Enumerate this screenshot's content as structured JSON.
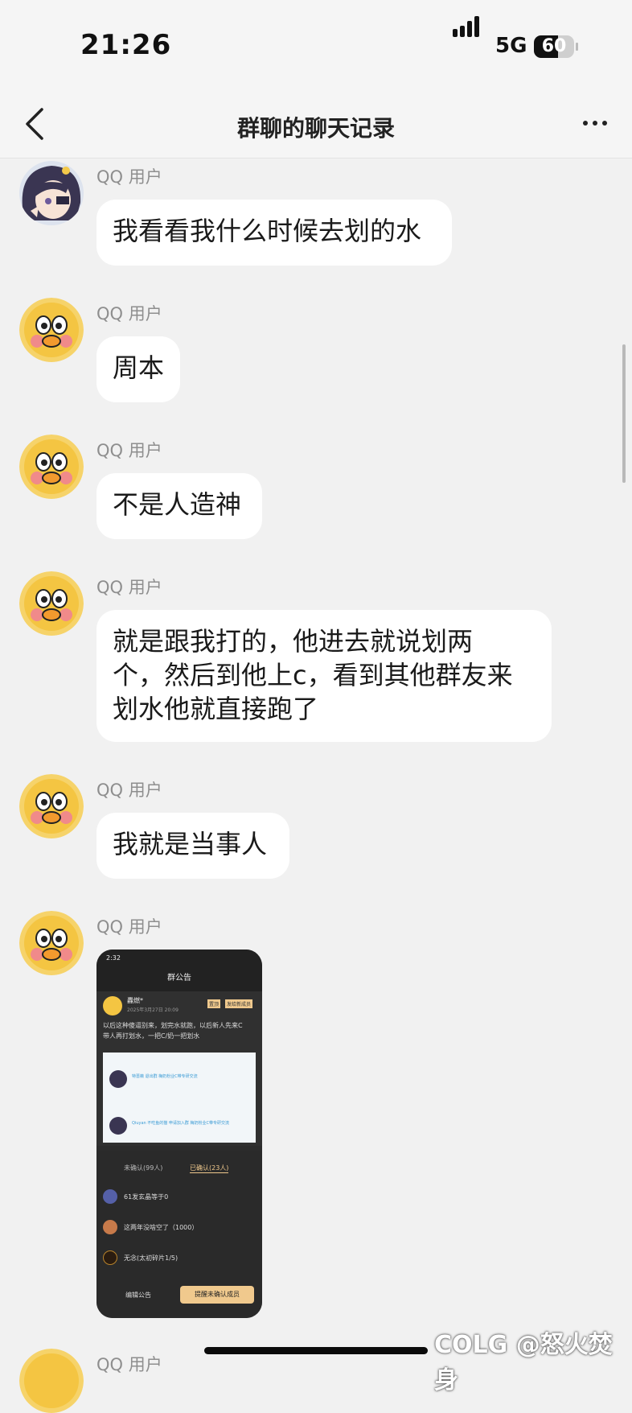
{
  "status_bar": {
    "time": "21:26",
    "network": "5G",
    "battery": "60",
    "battery_level": 0.6
  },
  "nav": {
    "title": "群聊的聊天记录"
  },
  "messages": [
    {
      "sender": "QQ 用户",
      "text": "我看看我什么时候去划的水"
    },
    {
      "sender": "QQ 用户",
      "text": "周本"
    },
    {
      "sender": "QQ 用户",
      "text": "不是人造神"
    },
    {
      "sender": "QQ 用户",
      "lines": [
        "就是跟我打的，他进去就说划两",
        "个，然后到他上c，看到其他群友来",
        "划水他就直接跑了"
      ]
    },
    {
      "sender": "QQ 用户",
      "text": "我就是当事人"
    },
    {
      "sender": "QQ 用户"
    },
    {
      "sender": "QQ 用户"
    }
  ],
  "embedded_screenshot": {
    "time": "2:32",
    "title": "群公告",
    "author": "轟燃*",
    "date": "2025年3月27日 20:09",
    "tag_pinned": "置顶",
    "tag_new": "发给新成员",
    "text_lines": [
      "以后这种傻逼别来，划完水就跑，以后新人先来C",
      "带人再打划水，一把C/奶一把划水"
    ],
    "img_row1": "特蔷薇 退出群 梅奶粉业C带专研交流",
    "img_row2": "Qiuyan 不吃鱼的猫 申请加入群 梅奶粉业C带专研交流",
    "tab_unconfirmed": "未确认(99人)",
    "tab_confirmed": "已确认(23人)",
    "members": [
      "61发玄晶等于0",
      "这两年没啥空了（1000）",
      "无念(太初碎片1/5)"
    ],
    "btn_edit": "编辑公告",
    "btn_remind": "提醒未确认成员"
  },
  "watermark": "COLG @怒火焚身"
}
